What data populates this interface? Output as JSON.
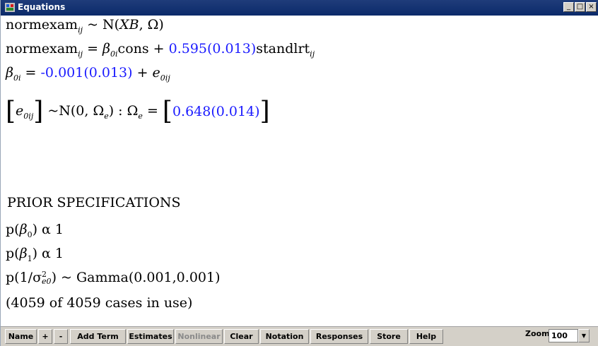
{
  "window": {
    "title": "Equations",
    "buttons": [
      "_",
      "□",
      "×"
    ]
  },
  "equations": {
    "line1": {
      "lhs": "normexam",
      "lhs_sub": "ij",
      "rest": " ~ N(",
      "xb": "XB",
      "omega": ", Ω)"
    },
    "line2": {
      "lhs": "normexam",
      "lhs_sub": "ij",
      "eq": " = ",
      "beta": "β",
      "beta_sub": "0i",
      "cons": "cons + ",
      "coef": "0.595(0.013)",
      "var": "standlrt",
      "var_sub": "ij"
    },
    "line3": {
      "beta": "β",
      "beta_sub": "0i",
      "eq": " = ",
      "coef": "-0.001(0.013)",
      "plus": " + ",
      "e": "e",
      "e_sub": "0ij"
    },
    "line4": {
      "e": "e",
      "e_sub": "0ij",
      "dist": "~N(0, Ω",
      "dist_sub": "e",
      "dist_end": ")  :  Ω",
      "omega_sub": "e",
      "eq": " = ",
      "value": "0.648(0.014)"
    },
    "prior_header": "PRIOR SPECIFICATIONS",
    "prior1": {
      "text_start": "p(",
      "beta": "β",
      "sub": "0",
      "text_end": ") α  1"
    },
    "prior2": {
      "text_start": "p(",
      "beta": "β",
      "sub": "1",
      "text_end": ") α  1"
    },
    "prior3": {
      "text_start": "p(1/σ",
      "sup": "2",
      "sub": "e0",
      "text_end": ") ~ Gamma(0.001,0.001)"
    },
    "cases": "(4059 of 4059 cases in use)"
  },
  "toolbar": {
    "name": "Name",
    "plus": "+",
    "minus": "-",
    "add_term": "Add Term",
    "estimates": "Estimates",
    "nonlinear": "Nonlinear",
    "clear": "Clear",
    "notation": "Notation",
    "responses": "Responses",
    "store": "Store",
    "help": "Help",
    "zoom_label": "Zoom",
    "zoom_value": "100"
  }
}
